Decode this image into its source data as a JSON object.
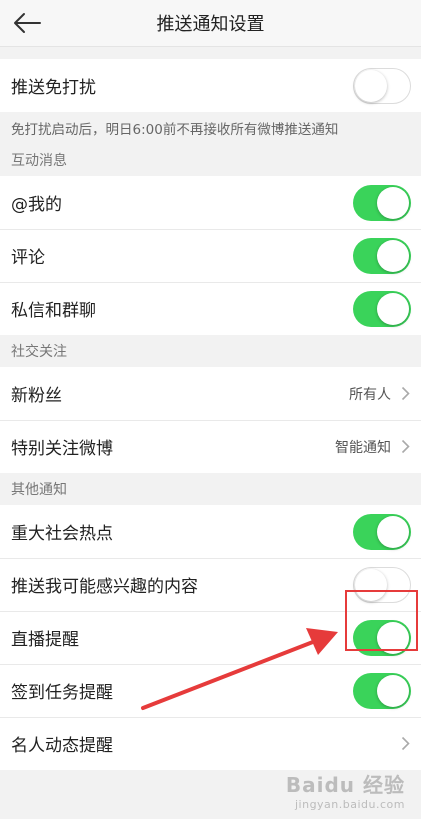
{
  "header": {
    "title": "推送通知设置",
    "back_icon": "arrow-left-icon"
  },
  "dnd": {
    "label": "推送免打扰",
    "enabled": false,
    "note": "免打扰启动后，明日6:00前不再接收所有微博推送通知"
  },
  "interaction": {
    "section_title": "互动消息",
    "items": [
      {
        "label": "@我的",
        "enabled": true
      },
      {
        "label": "评论",
        "enabled": true
      },
      {
        "label": "私信和群聊",
        "enabled": true
      }
    ]
  },
  "social": {
    "section_title": "社交关注",
    "items": [
      {
        "label": "新粉丝",
        "value": "所有人"
      },
      {
        "label": "特别关注微博",
        "value": "智能通知"
      }
    ]
  },
  "other": {
    "section_title": "其他通知",
    "items": [
      {
        "label": "重大社会热点",
        "enabled": true
      },
      {
        "label": "推送我可能感兴趣的内容",
        "enabled": false
      },
      {
        "label": "直播提醒",
        "enabled": true
      },
      {
        "label": "签到任务提醒",
        "enabled": true
      },
      {
        "label": "名人动态提醒"
      }
    ]
  },
  "colors": {
    "toggle_on": "#3ad35a",
    "annotation": "#e63b3b"
  },
  "watermark": {
    "line1": "Baidu 经验",
    "line2": "jingyan.baidu.com"
  }
}
